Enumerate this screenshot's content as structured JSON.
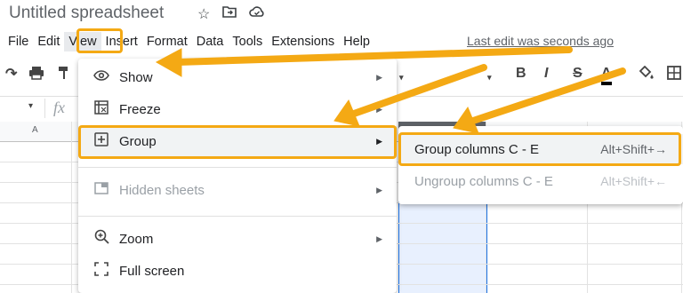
{
  "app": {
    "title": "Untitled spreadsheet",
    "title_icons": [
      "star-icon",
      "move-to-folder-icon",
      "cloud-status-icon"
    ],
    "last_edit": "Last edit was seconds ago"
  },
  "menubar": {
    "items": [
      "File",
      "Edit",
      "View",
      "Insert",
      "Format",
      "Data",
      "Tools",
      "Extensions",
      "Help"
    ],
    "active": "View"
  },
  "toolbar": {
    "bold": "B",
    "italic": "I",
    "strike": "S",
    "text_color": "A"
  },
  "formula_bar": {
    "fx": "fx"
  },
  "columns": {
    "first": "A"
  },
  "view_menu": {
    "items": [
      {
        "label": "Show",
        "icon": "eye-icon",
        "submenu": true
      },
      {
        "label": "Freeze",
        "icon": "freeze-icon",
        "submenu": true
      },
      {
        "label": "Group",
        "icon": "group-plus-icon",
        "submenu": true,
        "highlighted": true
      },
      {
        "label": "Hidden sheets",
        "icon": "hidden-sheets-icon",
        "submenu": true,
        "disabled": true
      },
      {
        "label": "Zoom",
        "icon": "zoom-icon",
        "submenu": true
      },
      {
        "label": "Full screen",
        "icon": "fullscreen-icon",
        "submenu": false
      }
    ]
  },
  "group_submenu": {
    "items": [
      {
        "label": "Group columns C - E",
        "shortcut": "Alt+Shift+→",
        "highlighted": true
      },
      {
        "label": "Ungroup columns C - E",
        "shortcut": "Alt+Shift+←",
        "disabled": true
      }
    ]
  },
  "colors": {
    "highlight": "#f4a914",
    "selection": "#e8f0fe",
    "selection_border": "#1a73e8"
  }
}
